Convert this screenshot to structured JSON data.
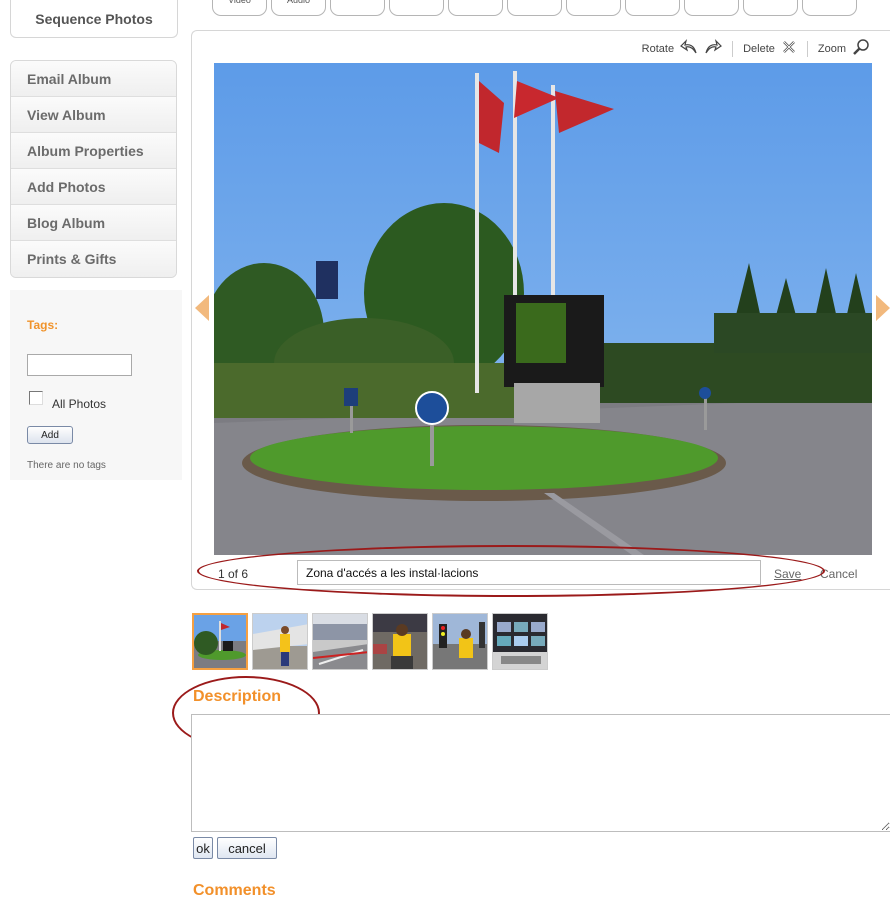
{
  "sidebar": {
    "sequence_photos": "Sequence Photos",
    "menu": [
      {
        "label": "Email Album"
      },
      {
        "label": "View Album"
      },
      {
        "label": "Album Properties"
      },
      {
        "label": "Add Photos"
      },
      {
        "label": "Blog Album"
      },
      {
        "label": "Prints & Gifts"
      }
    ],
    "tags": {
      "label": "Tags:",
      "input_value": "",
      "all_photos_label": "All Photos",
      "all_photos_checked": false,
      "add_label": "Add",
      "empty_text": "There are no tags"
    }
  },
  "top_tabs": [
    {
      "label": "Video"
    },
    {
      "label": "Audio"
    },
    {
      "label": ""
    },
    {
      "label": ""
    },
    {
      "label": ""
    },
    {
      "label": ""
    },
    {
      "label": ""
    },
    {
      "label": ""
    },
    {
      "label": ""
    },
    {
      "label": ""
    },
    {
      "label": ""
    }
  ],
  "viewer": {
    "toolbar": {
      "rotate_label": "Rotate",
      "delete_label": "Delete",
      "zoom_label": "Zoom"
    },
    "counter": "1 of 6",
    "caption_value": "Zona d'accés a les instal·lacions",
    "save_label": "Save",
    "cancel_label": "Cancel"
  },
  "thumbnails": [
    {
      "icon": "roundabout-photo",
      "active": true
    },
    {
      "icon": "person-photo"
    },
    {
      "icon": "grandstand-photo"
    },
    {
      "icon": "person-photo"
    },
    {
      "icon": "person-photo"
    },
    {
      "icon": "screens-photo"
    }
  ],
  "description": {
    "title": "Description",
    "value": "",
    "ok_label": "ok",
    "cancel_label": "cancel"
  },
  "comments": {
    "title": "Comments"
  },
  "colors": {
    "accent": "#f2902a",
    "annotation": "#9b1a1a"
  }
}
